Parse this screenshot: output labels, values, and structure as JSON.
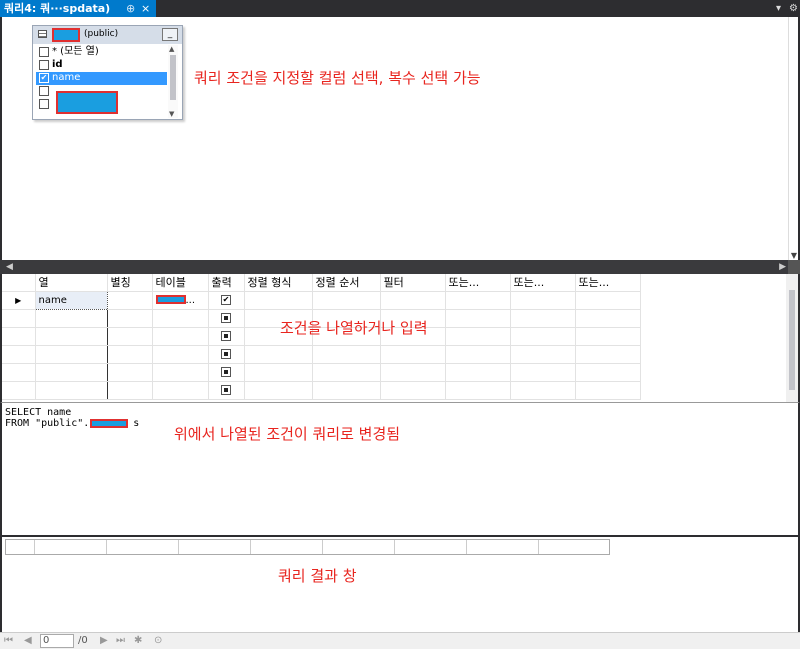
{
  "tab": {
    "title": "쿼리4: 쿼···spdata)",
    "pin_icon": "pin-icon",
    "close_icon": "close-icon",
    "menu_icon": "chevron-down-icon",
    "settings_icon": "gear-icon"
  },
  "diagram": {
    "table_schema": "(public)",
    "minimize_label": "_",
    "columns": [
      {
        "label": "* (모든 열)",
        "checked": false,
        "selected": false
      },
      {
        "label": "id",
        "checked": false,
        "selected": false
      },
      {
        "label": "name",
        "checked": true,
        "selected": true
      },
      {
        "label": "",
        "checked": false,
        "selected": false
      },
      {
        "label": "",
        "checked": false,
        "selected": false
      }
    ],
    "annotation": "쿼리 조건을 지정할 컬럼 선택, 복수 선택 가능"
  },
  "grid": {
    "headers": [
      "열",
      "별칭",
      "테이블",
      "출력",
      "정렬 형식",
      "정렬 순서",
      "필터",
      "또는...",
      "또는...",
      "또는..."
    ],
    "first_row": {
      "column": "name",
      "table_suffix": "..."
    },
    "annotation": "조건을 나열하거나 입력"
  },
  "sql": {
    "line1": "SELECT name",
    "line2": "FROM \"public\".",
    "line2_tail": "s",
    "annotation": "위에서 나열된 조건이 쿼리로 변경됨"
  },
  "results": {
    "annotation": "쿼리 결과 창"
  },
  "status": {
    "page_value": "0",
    "page_total": "/0"
  },
  "colors": {
    "accent": "#007acc",
    "annotation": "#e8251f",
    "redaction_fill": "#1a9ee0",
    "redaction_border": "#e03030"
  }
}
